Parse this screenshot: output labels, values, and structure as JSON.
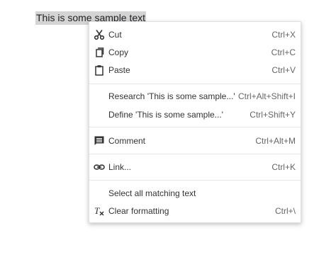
{
  "document": {
    "selected_text": "This is some sample text"
  },
  "context_menu": {
    "cut": {
      "label": "Cut",
      "shortcut": "Ctrl+X",
      "icon": "scissors-icon"
    },
    "copy": {
      "label": "Copy",
      "shortcut": "Ctrl+C",
      "icon": "copy-icon"
    },
    "paste": {
      "label": "Paste",
      "shortcut": "Ctrl+V",
      "icon": "paste-icon"
    },
    "research": {
      "label": "Research 'This is some sample...'",
      "shortcut": "Ctrl+Alt+Shift+I"
    },
    "define": {
      "label": "Define 'This is some sample...'",
      "shortcut": "Ctrl+Shift+Y"
    },
    "comment": {
      "label": "Comment",
      "shortcut": "Ctrl+Alt+M",
      "icon": "comment-icon"
    },
    "link": {
      "label": "Link...",
      "shortcut": "Ctrl+K",
      "icon": "link-icon"
    },
    "select_all": {
      "label": "Select all matching text"
    },
    "clear_formatting": {
      "label": "Clear formatting",
      "shortcut": "Ctrl+\\",
      "icon": "clear-formatting-icon"
    }
  }
}
